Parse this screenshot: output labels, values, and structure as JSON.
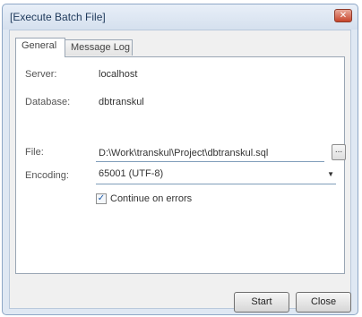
{
  "window": {
    "title": "[Execute Batch File]",
    "close_glyph": "✕"
  },
  "tabs": [
    {
      "label": "General",
      "active": true
    },
    {
      "label": "Message Log",
      "active": false
    }
  ],
  "form": {
    "server_label": "Server:",
    "server_value": "localhost",
    "database_label": "Database:",
    "database_value": "dbtranskul",
    "file_label": "File:",
    "file_value": "D:\\Work\\transkul\\Project\\dbtranskul.sql",
    "browse_label": "...",
    "encoding_label": "Encoding:",
    "encoding_value": "65001 (UTF-8)",
    "continue_label": "Continue on errors",
    "continue_checked": true,
    "check_glyph": "✓"
  },
  "buttons": {
    "start": "Start",
    "close": "Close"
  },
  "icons": {
    "close": "close-icon",
    "dropdown": "chevron-down-icon",
    "checkbox": "checkmark-icon"
  },
  "colors": {
    "title_text": "#1e395b",
    "close_button": "#c7442b",
    "frame": "#dfe8f3"
  }
}
